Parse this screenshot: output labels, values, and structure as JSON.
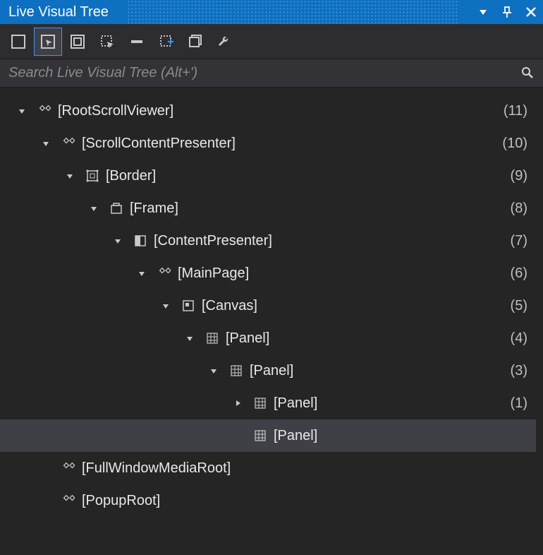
{
  "title": "Live Visual Tree",
  "search": {
    "placeholder": "Search Live Visual Tree (Alt+')"
  },
  "toolbar": {
    "items": [
      {
        "name": "select-element",
        "active": false
      },
      {
        "name": "enable-selection",
        "active": true
      },
      {
        "name": "display-layout-adorners",
        "active": false
      },
      {
        "name": "track-focused-element",
        "active": false
      },
      {
        "name": "toggle-runtime-tools",
        "active": false
      },
      {
        "name": "preview-selection",
        "active": false
      },
      {
        "name": "show-all",
        "active": false
      },
      {
        "name": "settings",
        "active": false
      }
    ]
  },
  "tree": [
    {
      "depth": 0,
      "expander": "expanded",
      "icon": "element",
      "label": "[RootScrollViewer]",
      "count": "(11)"
    },
    {
      "depth": 1,
      "expander": "expanded",
      "icon": "element",
      "label": "[ScrollContentPresenter]",
      "count": "(10)"
    },
    {
      "depth": 2,
      "expander": "expanded",
      "icon": "border",
      "label": "[Border]",
      "count": "(9)"
    },
    {
      "depth": 3,
      "expander": "expanded",
      "icon": "frame",
      "label": "[Frame]",
      "count": "(8)"
    },
    {
      "depth": 4,
      "expander": "expanded",
      "icon": "content",
      "label": "[ContentPresenter]",
      "count": "(7)"
    },
    {
      "depth": 5,
      "expander": "expanded",
      "icon": "element",
      "label": "[MainPage]",
      "count": "(6)"
    },
    {
      "depth": 6,
      "expander": "expanded",
      "icon": "canvas",
      "label": "[Canvas]",
      "count": "(5)"
    },
    {
      "depth": 7,
      "expander": "expanded",
      "icon": "grid",
      "label": "[Panel]",
      "count": "(4)"
    },
    {
      "depth": 8,
      "expander": "expanded",
      "icon": "grid",
      "label": "[Panel]",
      "count": "(3)"
    },
    {
      "depth": 9,
      "expander": "collapsed",
      "icon": "grid",
      "label": "[Panel]",
      "count": "(1)"
    },
    {
      "depth": 9,
      "expander": "none",
      "icon": "grid",
      "label": "[Panel]",
      "count": "",
      "selected": true
    },
    {
      "depth": 1,
      "expander": "none",
      "icon": "element",
      "label": "[FullWindowMediaRoot]",
      "count": ""
    },
    {
      "depth": 1,
      "expander": "none",
      "icon": "element",
      "label": "[PopupRoot]",
      "count": ""
    }
  ]
}
